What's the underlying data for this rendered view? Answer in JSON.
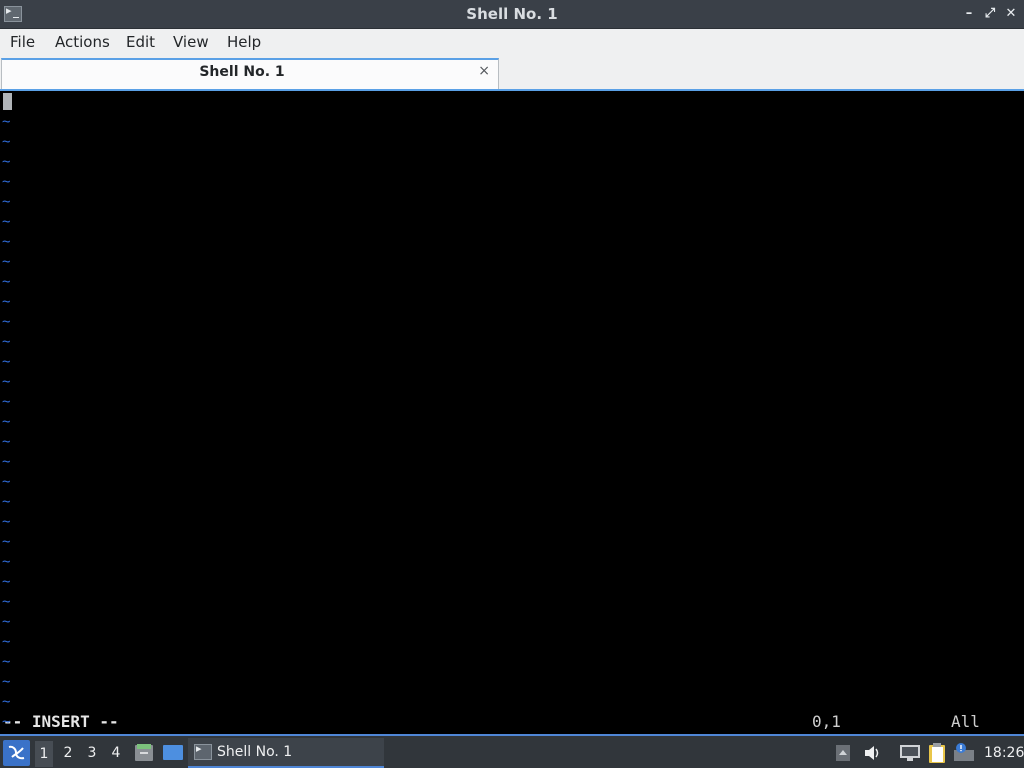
{
  "window": {
    "title": "Shell No. 1",
    "controls": {
      "minimize": "–",
      "maximize": "⤢",
      "close": "✕"
    }
  },
  "menubar": {
    "items": [
      "File",
      "Actions",
      "Edit",
      "View",
      "Help"
    ]
  },
  "tabs": [
    {
      "label": "Shell No. 1",
      "close": "×",
      "active": true
    }
  ],
  "terminal": {
    "tilde_char": "~",
    "tilde_count": 31,
    "mode": "-- INSERT --",
    "position": "0,1",
    "scroll": "All",
    "colors": {
      "background": "#000000",
      "tilde": "#2f6bd8",
      "text": "#e6e6e6"
    }
  },
  "taskbar": {
    "workspaces": [
      "1",
      "2",
      "3",
      "4"
    ],
    "active_workspace": "1",
    "launchers": [
      "file-manager-icon",
      "desktop-icon"
    ],
    "tasks": [
      {
        "label": "Shell No. 1",
        "icon": "terminal-icon"
      }
    ],
    "tray": [
      "tray-arrow-icon",
      "volume-icon",
      "network-icon",
      "clipboard-icon",
      "notification-icon"
    ],
    "clock": "18:26",
    "accent": "#4f86d6"
  }
}
